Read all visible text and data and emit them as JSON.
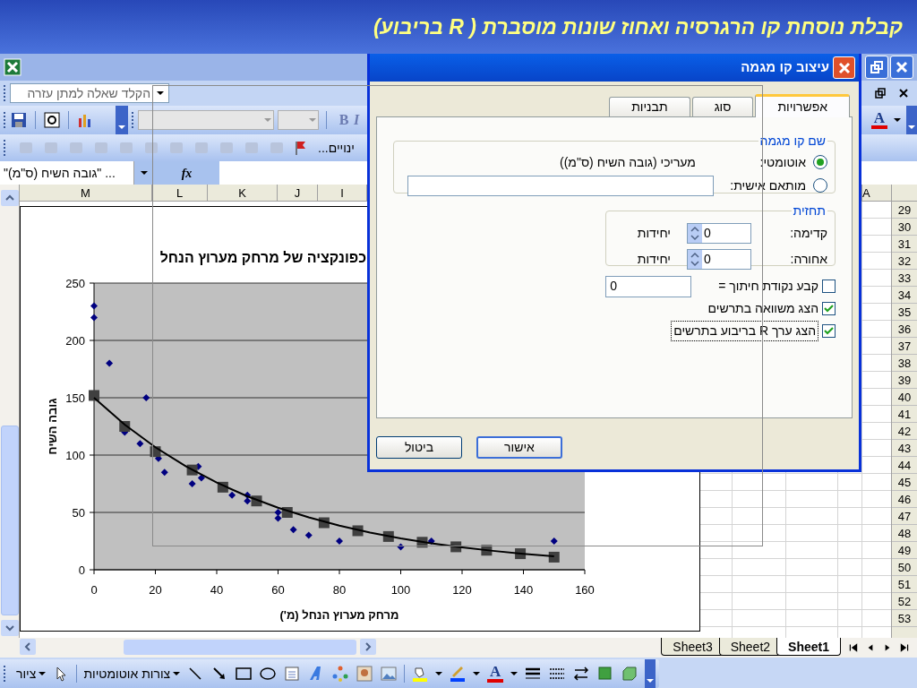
{
  "slide_title": "קבלת נוסחת קו הרגרסיה ואחוז שונות מוסברת ( R בריבוע)",
  "help_box": {
    "placeholder": "הקלד שאלה למתן עזרה"
  },
  "format_buttons": [
    "I",
    "B"
  ],
  "font_color_label": "A",
  "review_label": "ינויים...",
  "name_box": "\"(גובה השיח (ס\"מ\" ...",
  "fx_label": "fx",
  "columns": [
    "A",
    "I",
    "J",
    "K",
    "L",
    "M"
  ],
  "rows": [
    "29",
    "30",
    "31",
    "32",
    "33",
    "34",
    "35",
    "36",
    "37",
    "38",
    "39",
    "40",
    "41",
    "42",
    "43",
    "44",
    "45",
    "46",
    "47",
    "48",
    "49",
    "50",
    "51",
    "52",
    "53"
  ],
  "chart": {
    "chart_data": {
      "type": "scatter",
      "title": "כפונקציה של מרחק מערוץ הנחל",
      "xlabel": "מרחק מערוץ הנחל (מ')",
      "ylabel": "גובה השיח",
      "xlim": [
        0,
        160
      ],
      "ylim": [
        0,
        250
      ],
      "xticks": [
        0,
        20,
        40,
        60,
        80,
        100,
        120,
        140,
        160
      ],
      "yticks": [
        0,
        50,
        100,
        150,
        200,
        250
      ],
      "grid": true,
      "series": [
        {
          "type": "scatter",
          "color": "#000080",
          "x": [
            0,
            0,
            5,
            17,
            10,
            15,
            21,
            23,
            32,
            34,
            35,
            45,
            50,
            50,
            60,
            60,
            65,
            70,
            80,
            100,
            110,
            150
          ],
          "values": [
            230,
            220,
            180,
            150,
            120,
            110,
            97,
            85,
            75,
            90,
            80,
            65,
            65,
            60,
            50,
            45,
            35,
            30,
            25,
            20,
            25,
            25
          ]
        },
        {
          "type": "scatter",
          "color": "#404040",
          "x": [
            0,
            10,
            20,
            32,
            42,
            53,
            63,
            75,
            86,
            96,
            107,
            118,
            128,
            139,
            150
          ],
          "values": [
            152,
            125,
            103,
            87,
            72,
            60,
            50,
            41,
            34,
            29,
            24,
            20,
            17,
            14,
            11
          ]
        },
        {
          "type": "line",
          "color": "#000000",
          "x": [
            0,
            10,
            20,
            30,
            40,
            50,
            60,
            70,
            80,
            90,
            100,
            110,
            120,
            130,
            140,
            150
          ],
          "values": [
            150,
            126.5,
            106.8,
            90.1,
            76,
            64.1,
            54.1,
            45.7,
            38.5,
            32.5,
            27.4,
            23.1,
            19.5,
            16.5,
            13.9,
            11.7
          ]
        }
      ]
    }
  },
  "sheet_tabs": [
    {
      "label": "Sheet1",
      "selected": true
    },
    {
      "label": "Sheet2",
      "selected": false
    },
    {
      "label": "Sheet3",
      "selected": false
    }
  ],
  "drawing_toolbar": {
    "draw_menu": "ציור",
    "autoshapes_menu": "צורות אוטומטיות",
    "font_color_label": "A"
  },
  "dialog": {
    "title": "עיצוב קו מגמה",
    "tabs": [
      {
        "label": "אפשרויות",
        "selected": true
      },
      {
        "label": "סוג",
        "selected": false
      },
      {
        "label": "תבניות",
        "selected": false
      }
    ],
    "name_group": {
      "legend": "שם קו מגמה",
      "options": [
        {
          "label": "אוטומטי:",
          "selected": true,
          "value": "מעריכי (גובה השיח (ס\"מ))"
        },
        {
          "label": "מותאם אישית:",
          "selected": false
        }
      ]
    },
    "forecast": {
      "legend": "תחזית",
      "rows": [
        {
          "label": "קדימה:",
          "value": "0",
          "unit": "יחידות"
        },
        {
          "label": "אחורה:",
          "value": "0",
          "unit": "יחידות"
        }
      ]
    },
    "checks": [
      {
        "label": "קבע נקודת חיתוך =",
        "checked": false,
        "value": "0"
      },
      {
        "label": "הצג משוואה בתרשים",
        "checked": true
      },
      {
        "label": "הצג ערך R בריבוע בתרשים",
        "checked": true
      }
    ],
    "buttons": [
      {
        "label": "אישור",
        "kind": "default"
      },
      {
        "label": "ביטול",
        "kind": "normal"
      }
    ]
  }
}
